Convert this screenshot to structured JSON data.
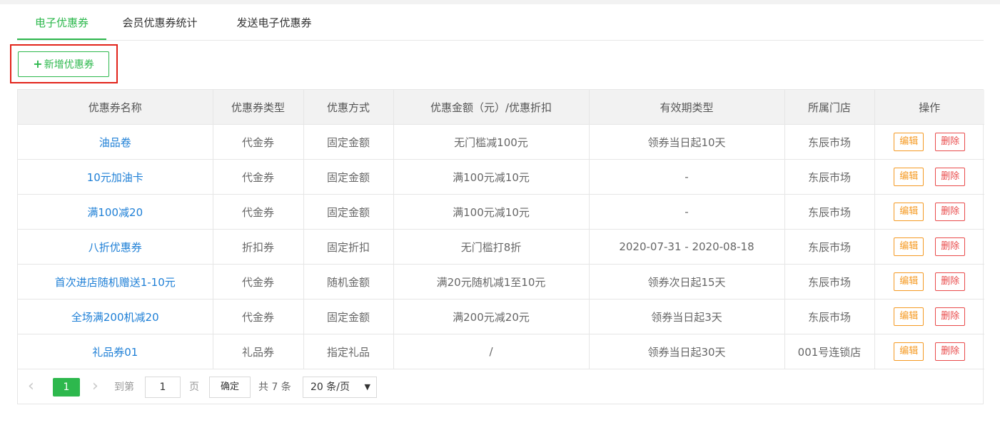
{
  "tabs": [
    {
      "label": "电子优惠券",
      "active": true
    },
    {
      "label": "会员优惠券统计",
      "active": false
    },
    {
      "label": "发送电子优惠券",
      "active": false
    }
  ],
  "toolbar": {
    "add_icon": "+",
    "add_label": "新增优惠券"
  },
  "table": {
    "headers": [
      "优惠券名称",
      "优惠券类型",
      "优惠方式",
      "优惠金额（元）/优惠折扣",
      "有效期类型",
      "所属门店",
      "操作"
    ],
    "edit_label": "编辑",
    "delete_label": "删除",
    "rows": [
      {
        "name": "油品卷",
        "type": "代金券",
        "method": "固定金额",
        "amount": "无门槛减100元",
        "validity": "领券当日起10天",
        "store": "东辰市场"
      },
      {
        "name": "10元加油卡",
        "type": "代金券",
        "method": "固定金额",
        "amount": "满100元减10元",
        "validity": "-",
        "store": "东辰市场"
      },
      {
        "name": "满100减20",
        "type": "代金券",
        "method": "固定金额",
        "amount": "满100元减10元",
        "validity": "-",
        "store": "东辰市场"
      },
      {
        "name": "八折优惠券",
        "type": "折扣券",
        "method": "固定折扣",
        "amount": "无门槛打8折",
        "validity": "2020-07-31 - 2020-08-18",
        "store": "东辰市场"
      },
      {
        "name": "首次进店随机赠送1-10元",
        "type": "代金券",
        "method": "随机金额",
        "amount": "满20元随机减1至10元",
        "validity": "领券次日起15天",
        "store": "东辰市场"
      },
      {
        "name": "全场满200机减20",
        "type": "代金券",
        "method": "固定金额",
        "amount": "满200元减20元",
        "validity": "领券当日起3天",
        "store": "东辰市场"
      },
      {
        "name": "礼品券01",
        "type": "礼品券",
        "method": "指定礼品",
        "amount": "/",
        "validity": "领券当日起30天",
        "store": "001号连锁店"
      }
    ]
  },
  "pagination": {
    "prev_icon": "‹",
    "current_page": "1",
    "next_icon": "›",
    "goto_label": "到第",
    "goto_value": "1",
    "page_label": "页",
    "confirm_label": "确定",
    "total_text": "共 7 条",
    "page_size": "20 条/页",
    "caret_icon": "▼"
  },
  "colors": {
    "accent": "#2db84d",
    "link": "#1e7fd6",
    "edit": "#f59a23",
    "delete": "#e94b4b",
    "highlight_box": "#e2231a"
  }
}
